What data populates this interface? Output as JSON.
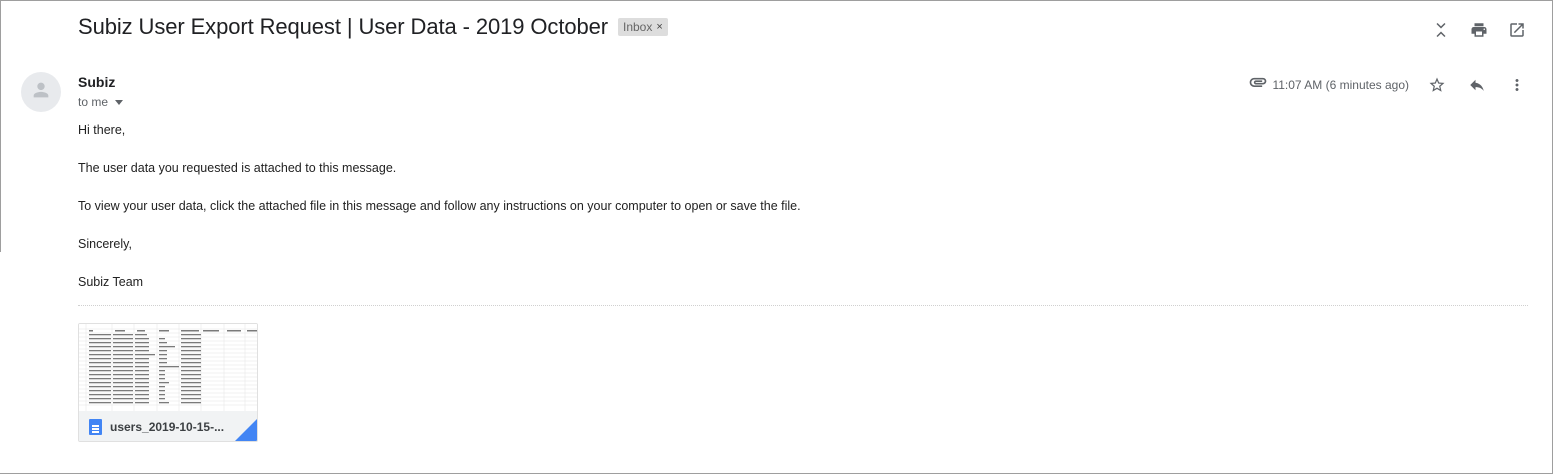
{
  "email": {
    "subject": "Subiz User Export Request | User Data - 2019 October",
    "label": "Inbox",
    "label_close": "×",
    "sender": "Subiz",
    "to": "to me",
    "time": "11:07 AM (6 minutes ago)",
    "body": {
      "greeting": "Hi there,",
      "line1": "The user data you requested is attached to this message.",
      "line2": "To view your user data, click the attached file in this message and follow any instructions on your computer to open or save the file.",
      "closing": "Sincerely,",
      "signature": "Subiz Team"
    },
    "attachment": {
      "name": "users_2019-10-15-...",
      "icon": "google-sheets-doc-icon"
    }
  },
  "icons": {
    "top_actions": [
      "expand-collapse-icon",
      "print-icon",
      "open-in-new-window-icon"
    ],
    "meta_actions": [
      "attachment-icon",
      "star-icon",
      "reply-icon",
      "more-vert-icon"
    ],
    "avatar": "default-avatar-icon"
  },
  "colors": {
    "accent": "#4285f4",
    "label_bg": "#dddddd",
    "muted_text": "#5f6368"
  }
}
